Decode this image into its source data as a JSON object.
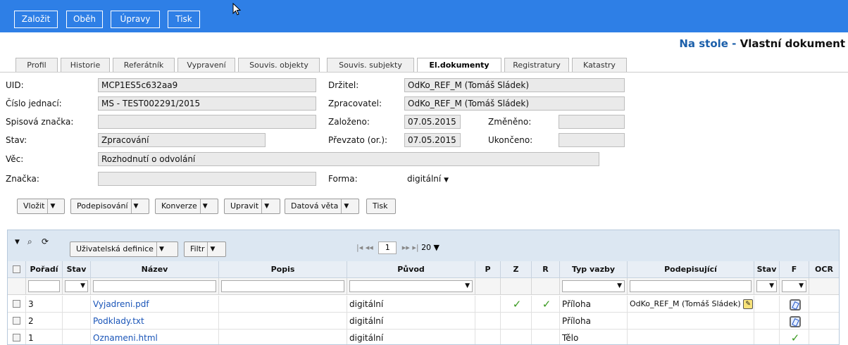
{
  "toolbar": [
    "Založit",
    "Oběh",
    "Úpravy",
    "Tisk"
  ],
  "heading": {
    "left": "Na stole",
    "sep": " - ",
    "right": "Vlastní dokument"
  },
  "tabs": [
    "Profil",
    "Historie",
    "Referátník",
    "Vypravení",
    "Souvis. objekty",
    "Souvis. subjekty",
    "El.dokumenty",
    "Registratury",
    "Katastry"
  ],
  "active_tab": "El.dokumenty",
  "form": {
    "uid_label": "UID:",
    "uid": "MCP1ES5c632aa9",
    "cj_label": "Číslo jednací:",
    "cj": "MS - TEST002291/2015",
    "sz_label": "Spisová značka:",
    "sz": "",
    "stav_label": "Stav:",
    "stav": "Zpracování",
    "vec_label": "Věc:",
    "vec": "Rozhodnutí o odvolání",
    "znacka_label": "Značka:",
    "znacka": "",
    "drzitel_label": "Držitel:",
    "drzitel": "OdKo_REF_M (Tomáš Sládek)",
    "zprac_label": "Zpracovatel:",
    "zprac": "OdKo_REF_M (Tomáš Sládek)",
    "zalozeno_label": "Založeno:",
    "zalozeno": "07.05.2015",
    "prevzato_label": "Převzato (or.):",
    "prevzato": "07.05.2015",
    "zmeneno_label": "Změněno:",
    "zmeneno": "",
    "ukonceno_label": "Ukončeno:",
    "ukonceno": "",
    "forma_label": "Forma:",
    "forma": "digitální"
  },
  "actions": [
    "Vložit",
    "Podepisování",
    "Konverze",
    "Upravit",
    "Datová věta",
    "Tisk"
  ],
  "grid": {
    "user_def": "Uživatelská definice",
    "filter": "Filtr",
    "page": "1",
    "page_size": "20",
    "columns": [
      "Pořadí",
      "Stav",
      "Název",
      "Popis",
      "Původ",
      "P",
      "Z",
      "R",
      "Typ vazby",
      "Podepisující",
      "Stav p",
      "F",
      "OCR"
    ],
    "rows": [
      {
        "poradi": "3",
        "nazev": "Vyjadreni.pdf",
        "puvod": "digitální",
        "z": "✓",
        "r": "✓",
        "typ": "Příloha",
        "podepisujici": "OdKo_REF_M (Tomáš Sládek)",
        "sig": true,
        "f": "icon"
      },
      {
        "poradi": "2",
        "nazev": "Podklady.txt",
        "puvod": "digitální",
        "z": "",
        "r": "",
        "typ": "Příloha",
        "podepisujici": "",
        "sig": false,
        "f": "icon"
      },
      {
        "poradi": "1",
        "nazev": "Oznameni.html",
        "puvod": "digitální",
        "z": "",
        "r": "",
        "typ": "Tělo",
        "podepisujici": "",
        "sig": false,
        "f": "tick"
      }
    ]
  },
  "colors": {
    "topbar": "#2e7fe6",
    "link": "#1a55b8",
    "heading_left": "#1b5faa"
  }
}
